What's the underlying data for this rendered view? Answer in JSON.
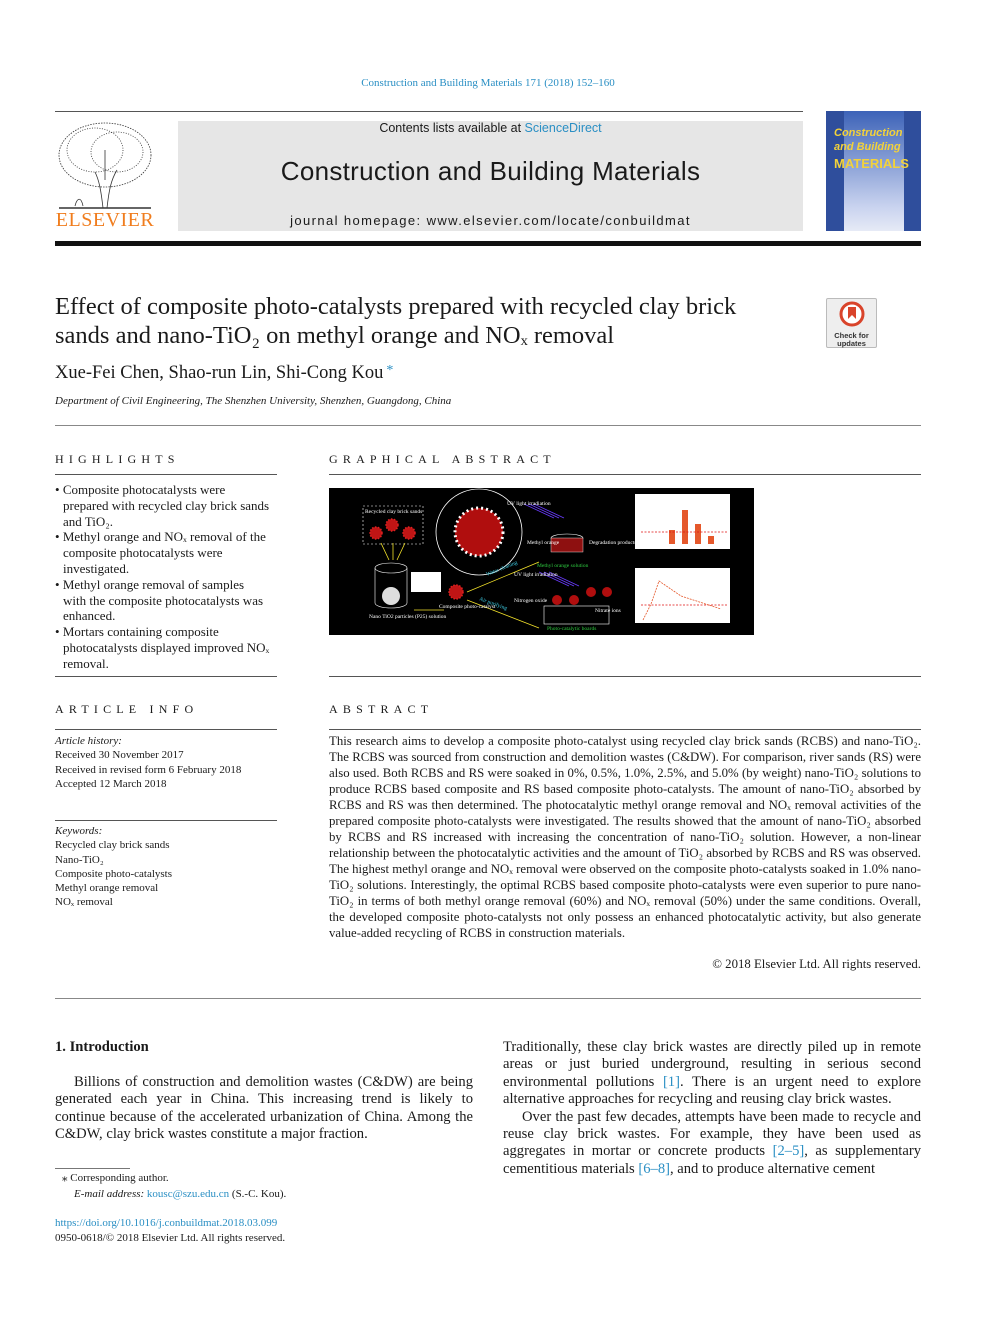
{
  "header": {
    "journal_ref": "Construction and Building Materials 171 (2018) 152–160",
    "contents_prefix": "Contents lists available at ",
    "contents_link": "ScienceDirect",
    "journal_title": "Construction and Building Materials",
    "homepage": "journal homepage: www.elsevier.com/locate/conbuildmat",
    "publisher_logo": "ELSEVIER",
    "cover_title_lines": [
      "Construction",
      "and Building",
      "MATERIALS"
    ],
    "badge_lines": [
      "Check for",
      "updates"
    ]
  },
  "article": {
    "title_line1": "Effect of composite photo-catalysts prepared with recycled clay brick",
    "title_line2": "sands and nano-TiO₂ on methyl orange and NOₓ removal",
    "authors": "Xue-Fei Chen, Shao-run Lin, Shi-Cong Kou",
    "author_mark": "*",
    "affiliation": "Department of Civil Engineering, The Shenzhen University, Shenzhen, Guangdong, China"
  },
  "highlights": {
    "heading": "HIGHLIGHTS",
    "items": [
      "Composite photocatalysts were prepared with recycled clay brick sands and TiO₂.",
      "Methyl orange and NOₓ removal of the composite photocatalysts were investigated.",
      "Methyl orange removal of samples with the composite photocatalysts was enhanced.",
      "Mortars containing composite photocatalysts displayed improved NOₓ removal."
    ]
  },
  "graphical_abstract": {
    "heading": "GRAPHICAL ABSTRACT",
    "labels": {
      "sands": "Recycled clay brick sands",
      "uv1": "UV light irradiation",
      "uv2": "UV light irradiation",
      "mo": "Methyl orange",
      "deg": "Degradation products",
      "mos": "Methyl orange solution",
      "water": "Water cleaning",
      "air": "Air purifying",
      "no": "Nitrogen oxide",
      "nitrate": "Nitrate ions",
      "boards": "Photo-catalytic boards",
      "composite": "Composite photo-catalyst",
      "tio2": "Nano TiO2 particles (P25) solution"
    }
  },
  "article_info": {
    "heading": "ARTICLE INFO",
    "history_label": "Article history:",
    "history": [
      "Received 30 November 2017",
      "Received in revised form 6 February 2018",
      "Accepted 12 March 2018"
    ],
    "keywords_label": "Keywords:",
    "keywords": [
      "Recycled clay brick sands",
      "Nano-TiO₂",
      "Composite photo-catalysts",
      "Methyl orange removal",
      "NOₓ removal"
    ]
  },
  "abstract": {
    "heading": "ABSTRACT",
    "text": "This research aims to develop a composite photo-catalyst using recycled clay brick sands (RCBS) and nano-TiO₂. The RCBS was sourced from construction and demolition wastes (C&DW). For comparison, river sands (RS) were also used. Both RCBS and RS were soaked in 0%, 0.5%, 1.0%, 2.5%, and 5.0% (by weight) nano-TiO₂ solutions to produce RCBS based composite and RS based composite photo-catalysts. The amount of nano-TiO₂ absorbed by RCBS and RS was then determined. The photocatalytic methyl orange removal and NOₓ removal activities of the prepared composite photo-catalysts were investigated. The results showed that the amount of nano-TiO₂ absorbed by RCBS and RS increased with increasing the concentration of nano-TiO₂ solution. However, a non-linear relationship between the photocatalytic activities and the amount of TiO₂ absorbed by RCBS and RS was observed. The highest methyl orange and NOₓ removal were observed on the composite photo-catalysts soaked in 1.0% nano-TiO₂ solutions. Interestingly, the optimal RCBS based composite photo-catalysts were even superior to pure nano-TiO₂ in terms of both methyl orange removal (60%) and NOₓ removal (50%) under the same conditions. Overall, the developed composite photo-catalysts not only possess an enhanced photocatalytic activity, but also generate value-added recycling of RCBS in construction materials.",
    "copyright": "© 2018 Elsevier Ltd. All rights reserved."
  },
  "introduction": {
    "heading": "1. Introduction",
    "left_paragraph": "Billions of construction and demolition wastes (C&DW) are being generated each year in China. This increasing trend is likely to continue because of the accelerated urbanization of China. Among the C&DW, clay brick wastes constitute a major fraction.",
    "right_p1": [
      "Traditionally, these clay brick wastes are directly piled up in remote areas or just buried underground, resulting in serious second environmental pollutions ",
      "[1]",
      ". There is an urgent need to explore alternative approaches for recycling and reusing clay brick wastes."
    ],
    "right_p2": [
      "Over the past few decades, attempts have been made to recycle and reuse clay brick wastes. For example, they have been used as aggregates in mortar or concrete products ",
      "[2–5]",
      ", as supplementary cementitious materials ",
      "[6–8]",
      ", and to produce alternative cement"
    ]
  },
  "footnote": {
    "mark": "⁎",
    "corresponding": "Corresponding author.",
    "email_label": "E-mail address:",
    "email": "kousc@szu.edu.cn",
    "email_suffix": " (S.-C. Kou).",
    "doi": "https://doi.org/10.1016/j.conbuildmat.2018.03.099",
    "issn": "0950-0618/© 2018 Elsevier Ltd. All rights reserved."
  },
  "colors": {
    "link": "#2a8fc4",
    "elsevier_orange": "#f07d1e",
    "cover_blue": "#2f4e9c",
    "masthead_gray": "#e6e6e6"
  }
}
